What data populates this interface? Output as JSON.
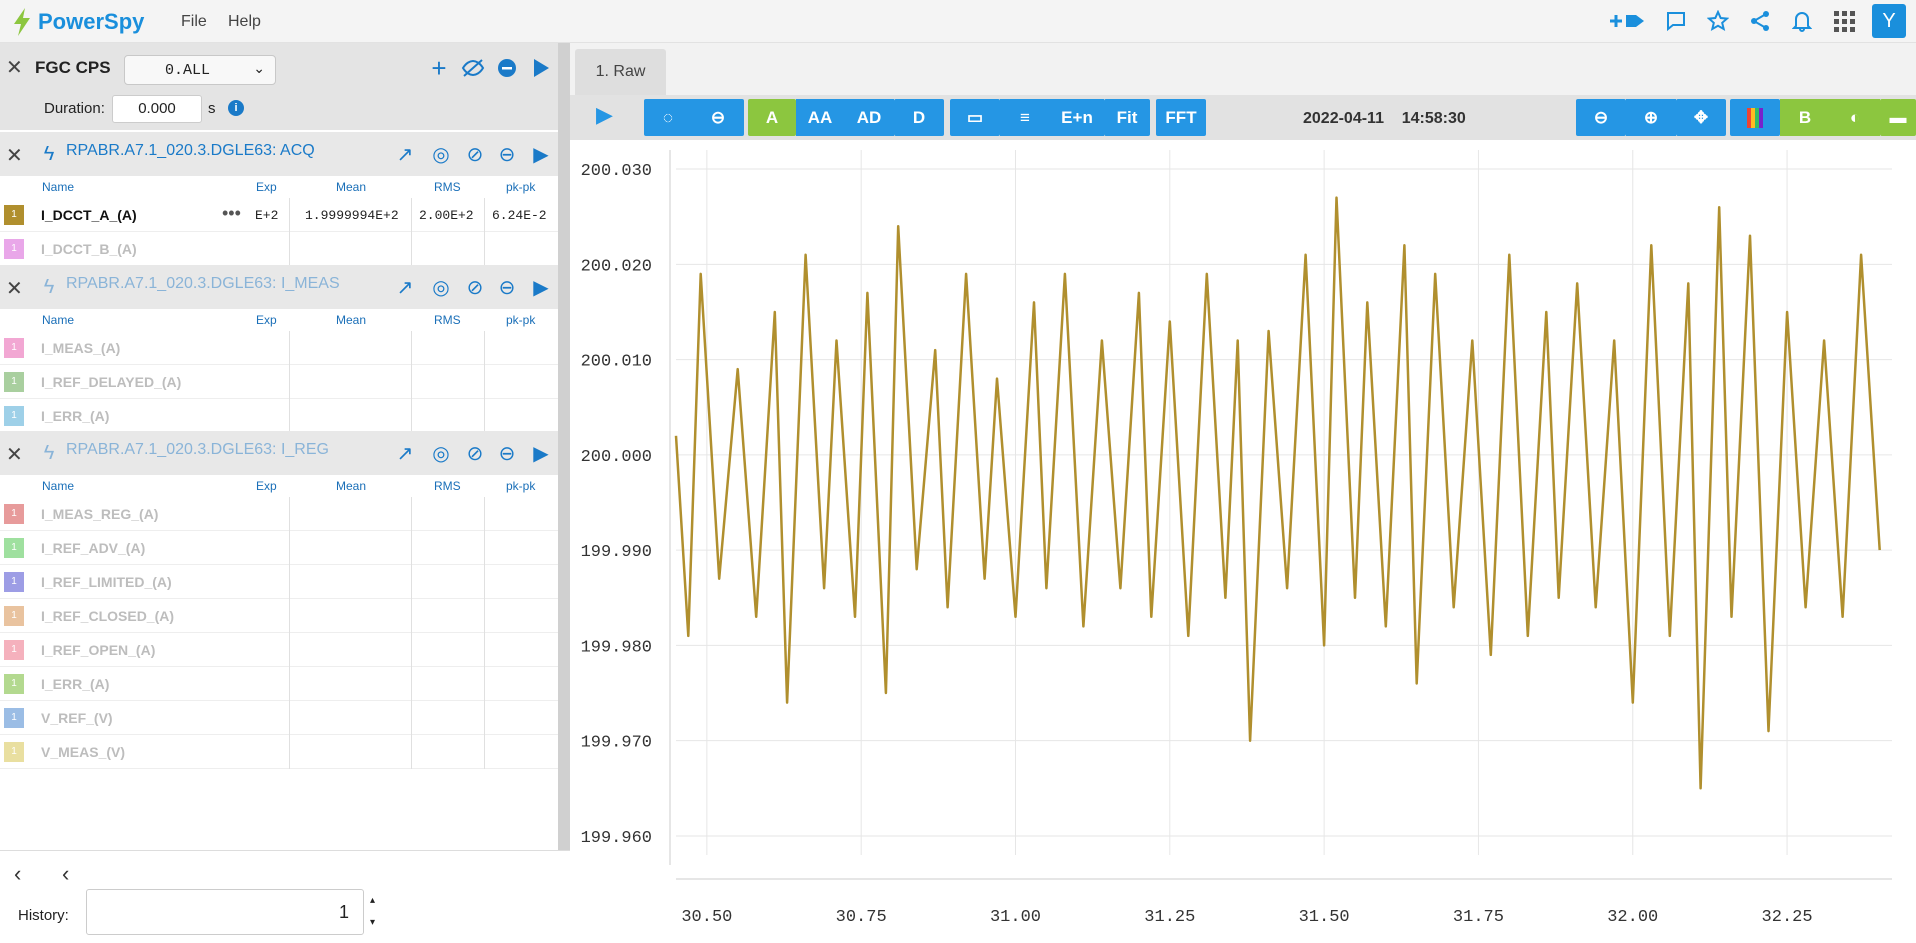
{
  "app": {
    "name": "PowerSpy",
    "menu": [
      "File",
      "Help"
    ],
    "user_initial": "Y"
  },
  "panel": {
    "title": "FGC CPS",
    "selector": "0.ALL",
    "duration_label": "Duration:",
    "duration_value": "0.000",
    "duration_unit": "s"
  },
  "columns": {
    "name": "Name",
    "exp": "Exp",
    "mean": "Mean",
    "rms": "RMS",
    "pkpk": "pk-pk"
  },
  "groups": [
    {
      "title": "RPABR.A7.1_020.3.DGLE63: ACQ",
      "active": true,
      "signals": [
        {
          "name": "I_DCCT_A_(A)",
          "on": true,
          "color": "#b08f2e",
          "exp": "E+2",
          "mean": "1.9999994E+2",
          "rms": "2.00E+2",
          "pkpk": "6.24E-2"
        },
        {
          "name": "I_DCCT_B_(A)",
          "on": false,
          "color": "#e9a7e9"
        }
      ]
    },
    {
      "title": "RPABR.A7.1_020.3.DGLE63: I_MEAS",
      "active": false,
      "signals": [
        {
          "name": "I_MEAS_(A)",
          "on": false,
          "color": "#f2a7d3"
        },
        {
          "name": "I_REF_DELAYED_(A)",
          "on": false,
          "color": "#a9cf9f"
        },
        {
          "name": "I_ERR_(A)",
          "on": false,
          "color": "#9ed0e8"
        }
      ]
    },
    {
      "title": "RPABR.A7.1_020.3.DGLE63: I_REG",
      "active": false,
      "signals": [
        {
          "name": "I_MEAS_REG_(A)",
          "on": false,
          "color": "#e79b9b"
        },
        {
          "name": "I_REF_ADV_(A)",
          "on": false,
          "color": "#9fe09f"
        },
        {
          "name": "I_REF_LIMITED_(A)",
          "on": false,
          "color": "#9d9de5"
        },
        {
          "name": "I_REF_CLOSED_(A)",
          "on": false,
          "color": "#e9c39f"
        },
        {
          "name": "I_REF_OPEN_(A)",
          "on": false,
          "color": "#f5b1bd"
        },
        {
          "name": "I_ERR_(A)",
          "on": false,
          "color": "#b3d98f"
        },
        {
          "name": "V_REF_(V)",
          "on": false,
          "color": "#9bbde5"
        },
        {
          "name": "V_MEAS_(V)",
          "on": false,
          "color": "#e9dfa0"
        }
      ]
    }
  ],
  "history": {
    "label": "History:",
    "value": "1"
  },
  "tab": {
    "label": "1. Raw"
  },
  "toolbar": {
    "a": "A",
    "aa": "AA",
    "ad": "AD",
    "d": "D",
    "en": "E+n",
    "fit": "Fit",
    "fft": "FFT",
    "b": "B",
    "date": "2022-04-11",
    "time": "14:58:30"
  },
  "colors": {
    "accent": "#2596e4",
    "green": "#8cc63f",
    "series": "#b08f2e"
  },
  "chart_data": {
    "type": "line",
    "title": "",
    "xlabel": "",
    "ylabel": "",
    "xlim": [
      30.45,
      32.42
    ],
    "ylim": [
      199.958,
      200.032
    ],
    "xticks": [
      30.5,
      30.75,
      31.0,
      31.25,
      31.5,
      31.75,
      32.0,
      32.25
    ],
    "xtick_labels": [
      "30.50",
      "30.75",
      "31.00",
      "31.25",
      "31.50",
      "31.75",
      "32.00",
      "32.25"
    ],
    "yticks": [
      199.96,
      199.97,
      199.98,
      199.99,
      200.0,
      200.01,
      200.02,
      200.03
    ],
    "ytick_labels": [
      "199.960",
      "199.970",
      "199.980",
      "199.990",
      "200.000",
      "200.010",
      "200.020",
      "200.030"
    ],
    "grid": true,
    "series": [
      {
        "name": "I_DCCT_A_(A)",
        "x": [
          30.45,
          30.47,
          30.49,
          30.52,
          30.55,
          30.58,
          30.61,
          30.63,
          30.66,
          30.69,
          30.71,
          30.74,
          30.76,
          30.79,
          30.81,
          30.84,
          30.87,
          30.89,
          30.92,
          30.95,
          30.97,
          31.0,
          31.03,
          31.05,
          31.08,
          31.11,
          31.14,
          31.17,
          31.2,
          31.22,
          31.25,
          31.28,
          31.31,
          31.34,
          31.36,
          31.38,
          31.41,
          31.44,
          31.47,
          31.5,
          31.52,
          31.55,
          31.57,
          31.6,
          31.63,
          31.65,
          31.68,
          31.71,
          31.74,
          31.77,
          31.8,
          31.83,
          31.86,
          31.88,
          31.91,
          31.94,
          31.97,
          32.0,
          32.03,
          32.06,
          32.09,
          32.11,
          32.14,
          32.16,
          32.19,
          32.22,
          32.25,
          32.28,
          32.31,
          32.34,
          32.37,
          32.4
        ],
        "y": [
          200.002,
          199.981,
          200.019,
          199.987,
          200.009,
          199.983,
          200.015,
          199.974,
          200.021,
          199.986,
          200.012,
          199.983,
          200.017,
          199.975,
          200.024,
          199.988,
          200.011,
          199.984,
          200.019,
          199.987,
          200.008,
          199.983,
          200.016,
          199.986,
          200.019,
          199.982,
          200.012,
          199.986,
          200.017,
          199.983,
          200.014,
          199.981,
          200.019,
          199.985,
          200.012,
          199.97,
          200.013,
          199.986,
          200.021,
          199.98,
          200.027,
          199.985,
          200.016,
          199.982,
          200.022,
          199.976,
          200.019,
          199.984,
          200.012,
          199.979,
          200.021,
          199.981,
          200.015,
          199.985,
          200.018,
          199.984,
          200.012,
          199.974,
          200.022,
          199.981,
          200.018,
          199.965,
          200.026,
          199.983,
          200.023,
          199.971,
          200.015,
          199.984,
          200.012,
          199.983,
          200.021,
          199.99
        ]
      }
    ]
  }
}
